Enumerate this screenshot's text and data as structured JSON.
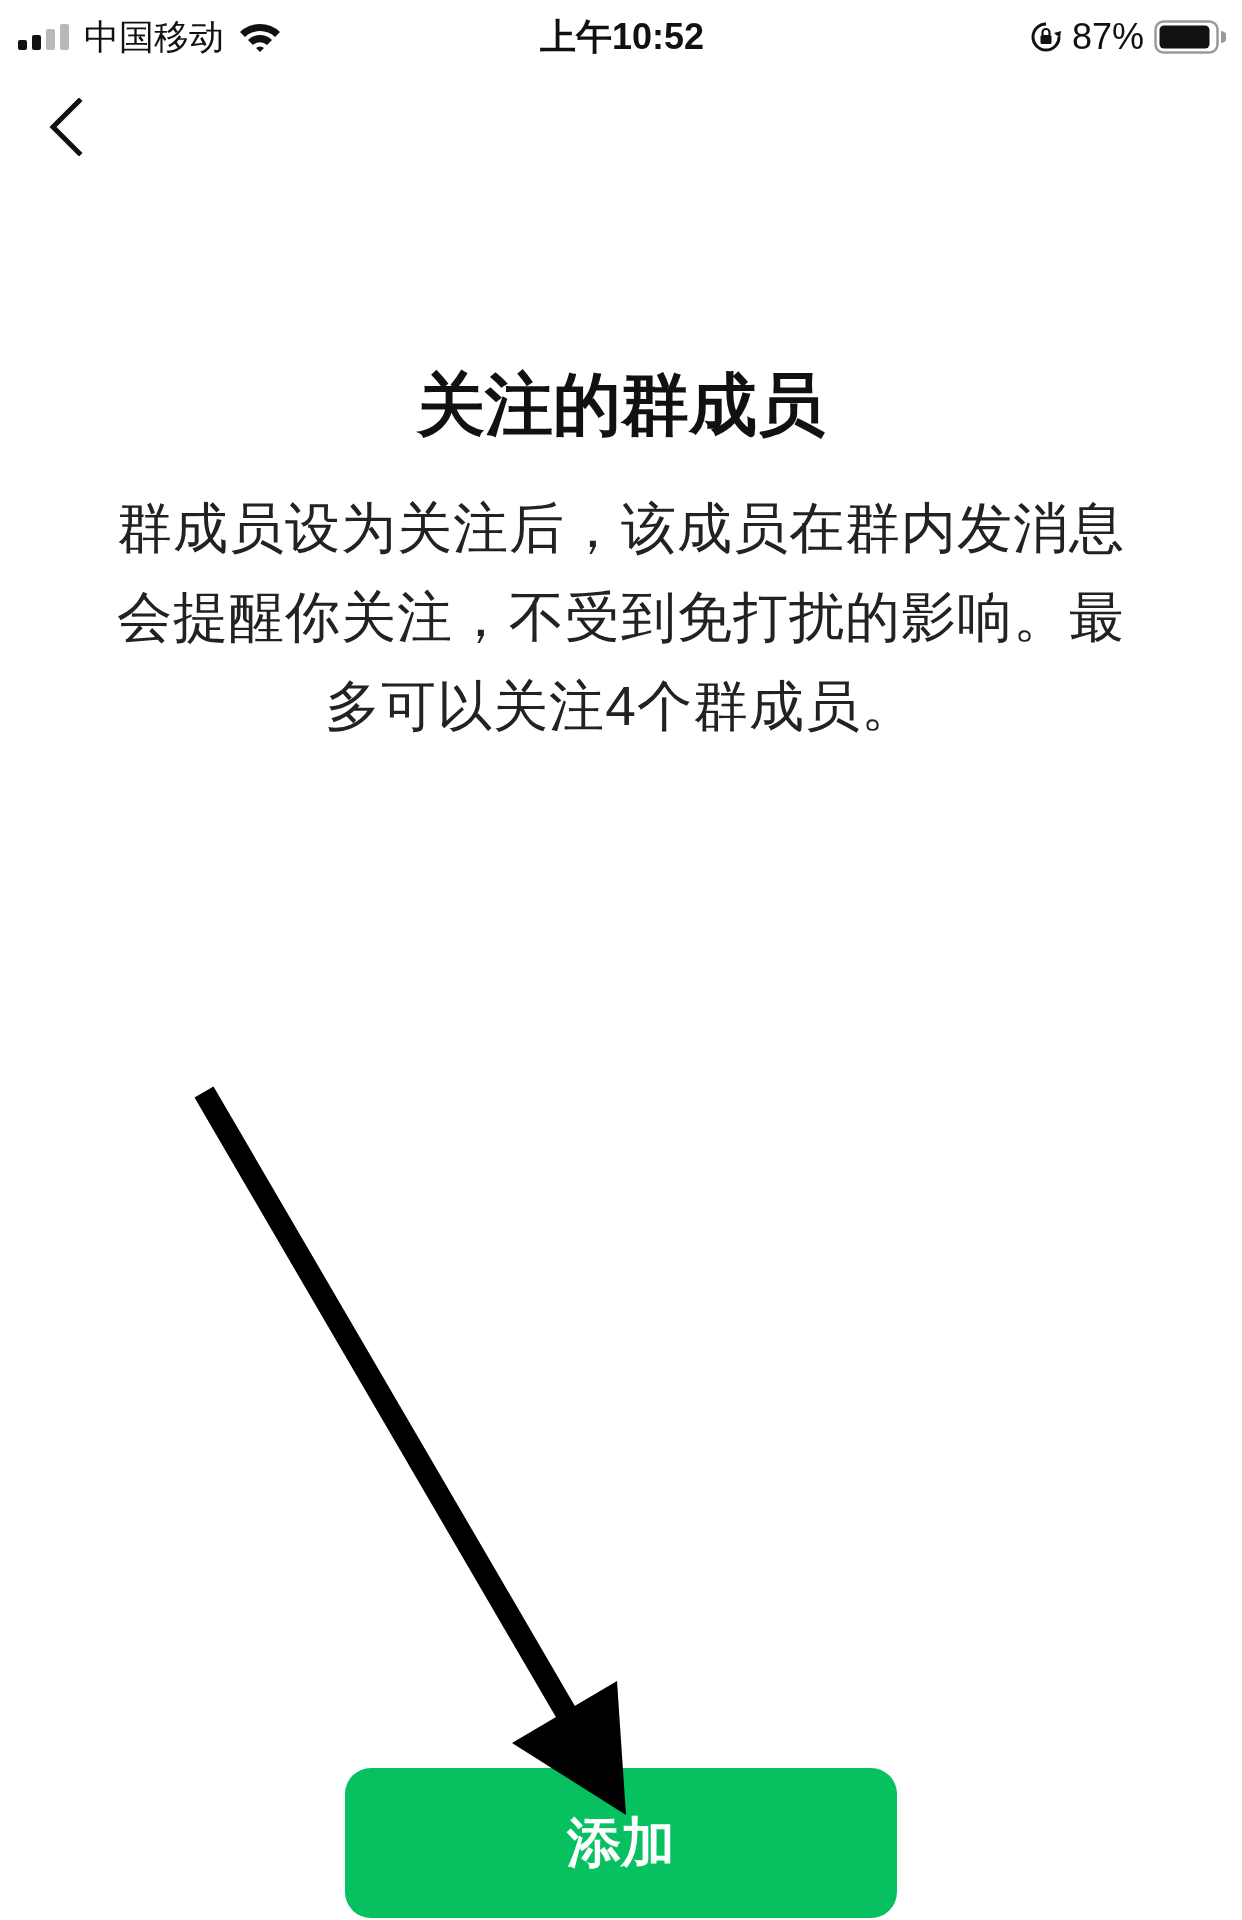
{
  "status_bar": {
    "carrier": "中国移动",
    "time": "上午10:52",
    "battery_percent": "87%"
  },
  "page": {
    "title": "关注的群成员",
    "description": "群成员设为关注后，该成员在群内发消息会提醒你关注，不受到免打扰的影响。最多可以关注4个群成员。"
  },
  "button": {
    "label": "添加"
  }
}
